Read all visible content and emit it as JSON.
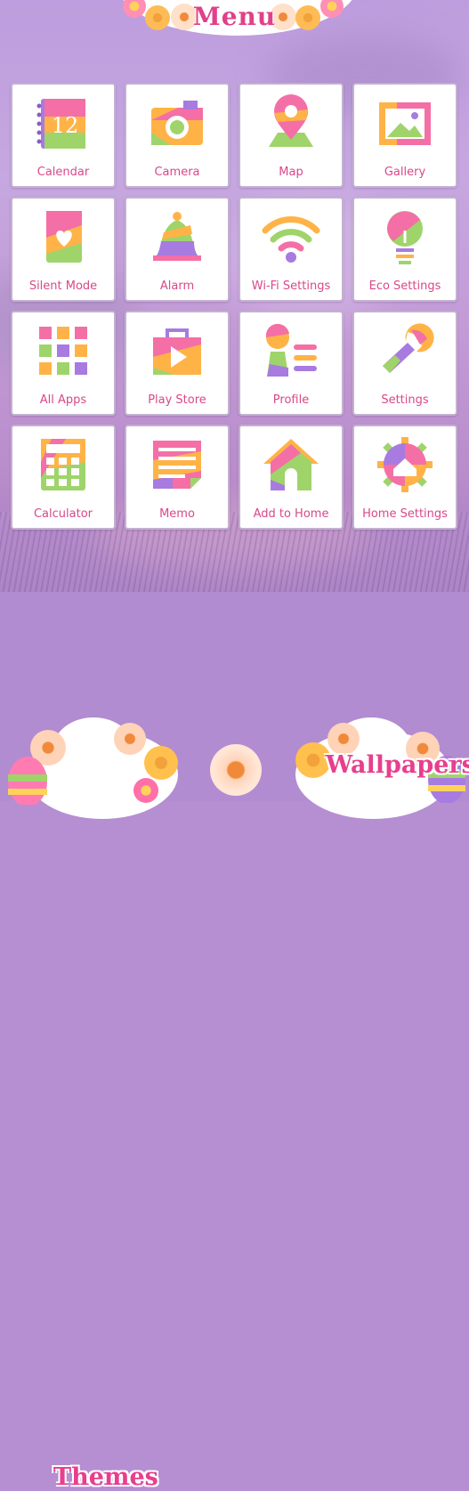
{
  "header": {
    "title": "Menu"
  },
  "tiles": [
    {
      "label": "Calendar",
      "icon": "calendar-icon",
      "text": "12"
    },
    {
      "label": "Camera",
      "icon": "camera-icon"
    },
    {
      "label": "Map",
      "icon": "map-pin-icon"
    },
    {
      "label": "Gallery",
      "icon": "gallery-icon"
    },
    {
      "label": "Silent Mode",
      "icon": "silent-mode-icon"
    },
    {
      "label": "Alarm",
      "icon": "bell-icon"
    },
    {
      "label": "Wi-Fi Settings",
      "icon": "wifi-icon"
    },
    {
      "label": "Eco Settings",
      "icon": "lightbulb-icon"
    },
    {
      "label": "All Apps",
      "icon": "apps-grid-icon"
    },
    {
      "label": "Play Store",
      "icon": "play-store-icon"
    },
    {
      "label": "Profile",
      "icon": "profile-icon"
    },
    {
      "label": "Settings",
      "icon": "wrench-icon"
    },
    {
      "label": "Calculator",
      "icon": "calculator-icon"
    },
    {
      "label": "Memo",
      "icon": "memo-icon"
    },
    {
      "label": "Add to Home",
      "icon": "house-icon"
    },
    {
      "label": "Home Settings",
      "icon": "home-settings-gear-icon"
    }
  ],
  "buttons": {
    "themes": "Themes",
    "wallpapers": "Wallpapers"
  },
  "colors": {
    "accent": "#e0418a",
    "background": "#b58fd2",
    "tile_border": "#c3b2cf",
    "pink": "#f46fa6",
    "orange": "#ffb347",
    "green": "#9fd46a",
    "purple": "#a77be0"
  }
}
